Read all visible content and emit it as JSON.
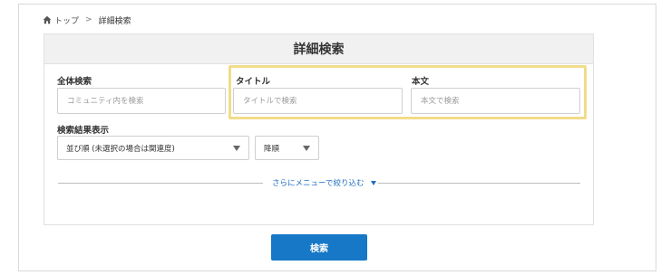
{
  "breadcrumb": {
    "home_icon": "home-icon",
    "home_label": "トップ",
    "separator": ">",
    "current_label": "詳細検索"
  },
  "panel": {
    "title": "詳細検索"
  },
  "fields": {
    "all": {
      "label": "全体検索",
      "placeholder": "コミュニティ内を検索",
      "value": ""
    },
    "title": {
      "label": "タイトル",
      "placeholder": "タイトルで検索",
      "value": ""
    },
    "body": {
      "label": "本文",
      "placeholder": "本文で検索",
      "value": ""
    }
  },
  "results": {
    "label": "検索結果表示",
    "sort_select": "並び順 (未選択の場合は関連度)",
    "order_select": "降順"
  },
  "more": {
    "label": "さらにメニューで絞り込む",
    "icon": "triangle-down-icon"
  },
  "submit": {
    "label": "検索"
  },
  "colors": {
    "accent": "#1678c6",
    "highlight": "#f1dc8a",
    "link": "#1f70c1"
  }
}
